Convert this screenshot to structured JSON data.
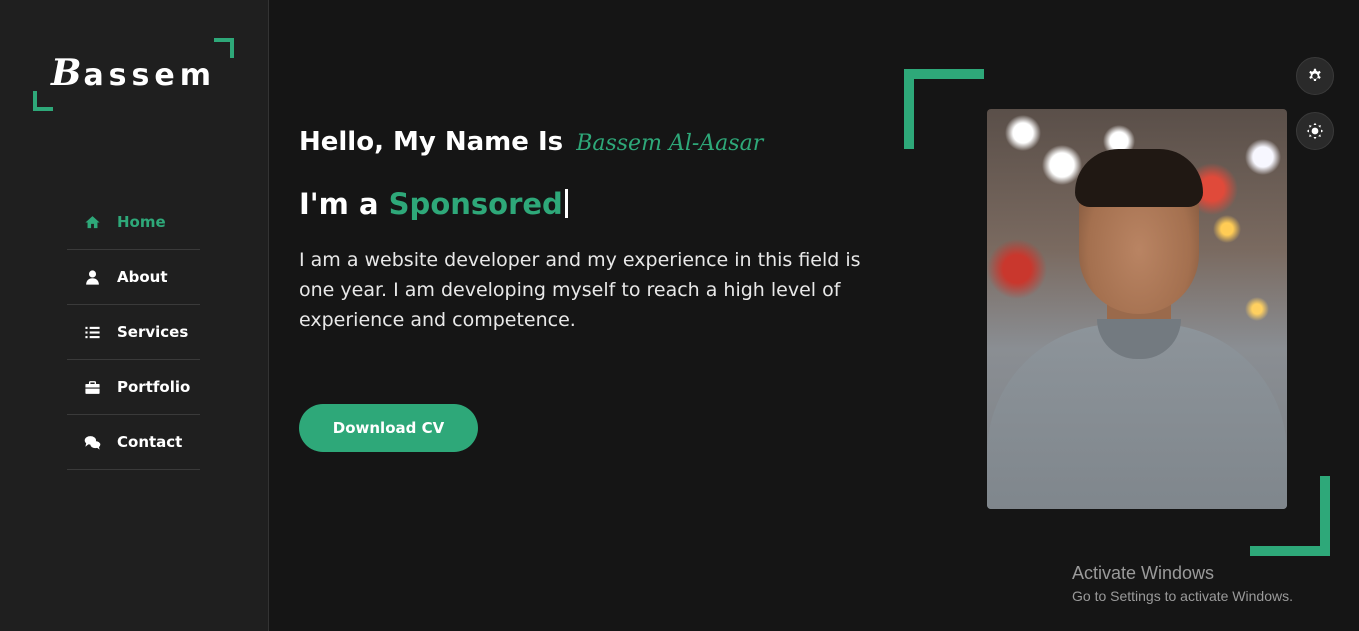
{
  "brand": {
    "logo_initial": "B",
    "logo_rest": "assem"
  },
  "colors": {
    "accent": "#2ea879",
    "background": "#151515",
    "sidebar": "#1f1f1f"
  },
  "nav": {
    "items": [
      {
        "label": "Home",
        "icon": "home-icon",
        "active": true
      },
      {
        "label": "About",
        "icon": "user-icon",
        "active": false
      },
      {
        "label": "Services",
        "icon": "list-icon",
        "active": false
      },
      {
        "label": "Portfolio",
        "icon": "briefcase-icon",
        "active": false
      },
      {
        "label": "Contact",
        "icon": "chat-icon",
        "active": false
      }
    ]
  },
  "hero": {
    "greeting": "Hello, My Name Is",
    "name": "Bassem Al-Aasar",
    "role_prefix": "I'm a",
    "role_typed": "Sponsored",
    "description": "I am a website developer and my experience in this field is one year. I am developing myself to reach a high level of experience and competence.",
    "download_label": "Download CV"
  },
  "floating": {
    "settings_icon": "gear-icon",
    "theme_icon": "sun-icon"
  },
  "watermark": {
    "title": "Activate Windows",
    "subtitle": "Go to Settings to activate Windows."
  }
}
